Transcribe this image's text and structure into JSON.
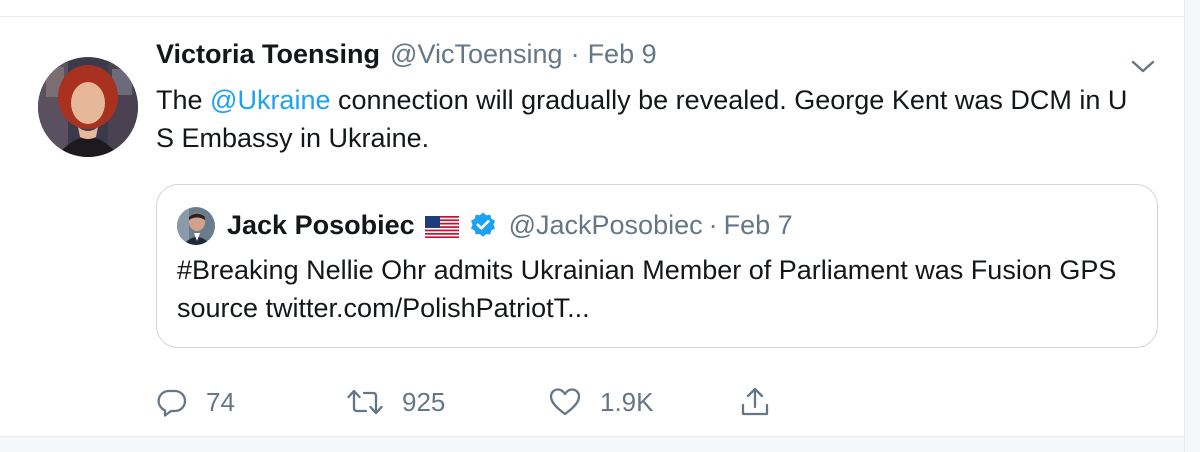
{
  "tweet": {
    "author_name": "Victoria Toensing",
    "author_handle": "@VicToensing",
    "separator": "·",
    "date": "Feb 9",
    "text_prefix": "The ",
    "mention": "@Ukraine",
    "text_suffix": " connection will gradually be revealed.  George Kent was DCM in U S Embassy in Ukraine.",
    "avatar_icon": "avatar-photo-icon",
    "menu_icon": "chevron-down-icon"
  },
  "quoted_tweet": {
    "author_name": "Jack Posobiec",
    "flag_icon": "us-flag-icon",
    "verified_icon": "verified-badge-icon",
    "author_handle": "@JackPosobiec",
    "separator": "·",
    "date": "Feb 7",
    "text": "#Breaking Nellie Ohr admits Ukrainian Member of Parliament was Fusion GPS source twitter.com/PolishPatriotT..."
  },
  "actions": {
    "reply_count": "74",
    "retweet_count": "925",
    "like_count": "1.9K",
    "reply_icon": "reply-icon",
    "retweet_icon": "retweet-icon",
    "like_icon": "heart-icon",
    "share_icon": "share-icon"
  },
  "colors": {
    "link": "#1da1f2",
    "secondary_text": "#657786",
    "primary_text": "#14171a",
    "border": "#ccd6dd",
    "verified": "#1da1f2"
  }
}
